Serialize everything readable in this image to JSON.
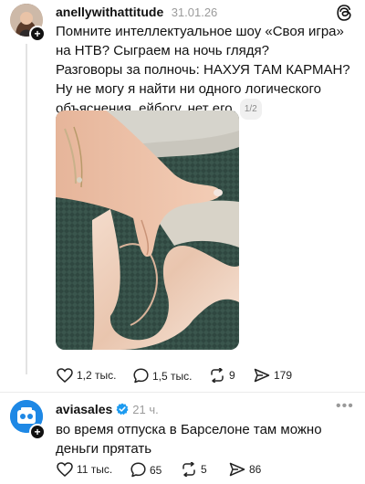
{
  "post1": {
    "username": "anellywithattitude",
    "date": "31.01.26",
    "paragraph1": "Помните интеллектуальное шоу «Своя игра» на НТВ? Сыграем на ночь глядя?",
    "paragraph2": "Разговоры за полночь: НАХУЯ ТАМ КАРМАН? Ну не могу я найти ни одного логического объяснения, ейбогу, нет его.",
    "page_indicator": "1/2",
    "likes": "1,2 тыс.",
    "comments": "1,5 тыс.",
    "reposts": "9",
    "shares": "179"
  },
  "post2": {
    "username": "aviasales",
    "time": "21 ч.",
    "text": "во время отпуска в Барселоне там можно деньги прятать",
    "likes": "11 тыс.",
    "comments": "65",
    "reposts": "5",
    "shares": "86"
  },
  "icons": {
    "app": "threads-icon",
    "verified": "verified-badge-icon",
    "like": "heart-icon",
    "comment": "comment-icon",
    "repost": "repost-icon",
    "share": "share-icon",
    "more": "more-icon"
  },
  "colors": {
    "verified": "#1d9bf0",
    "meta": "#9b9b9b"
  }
}
